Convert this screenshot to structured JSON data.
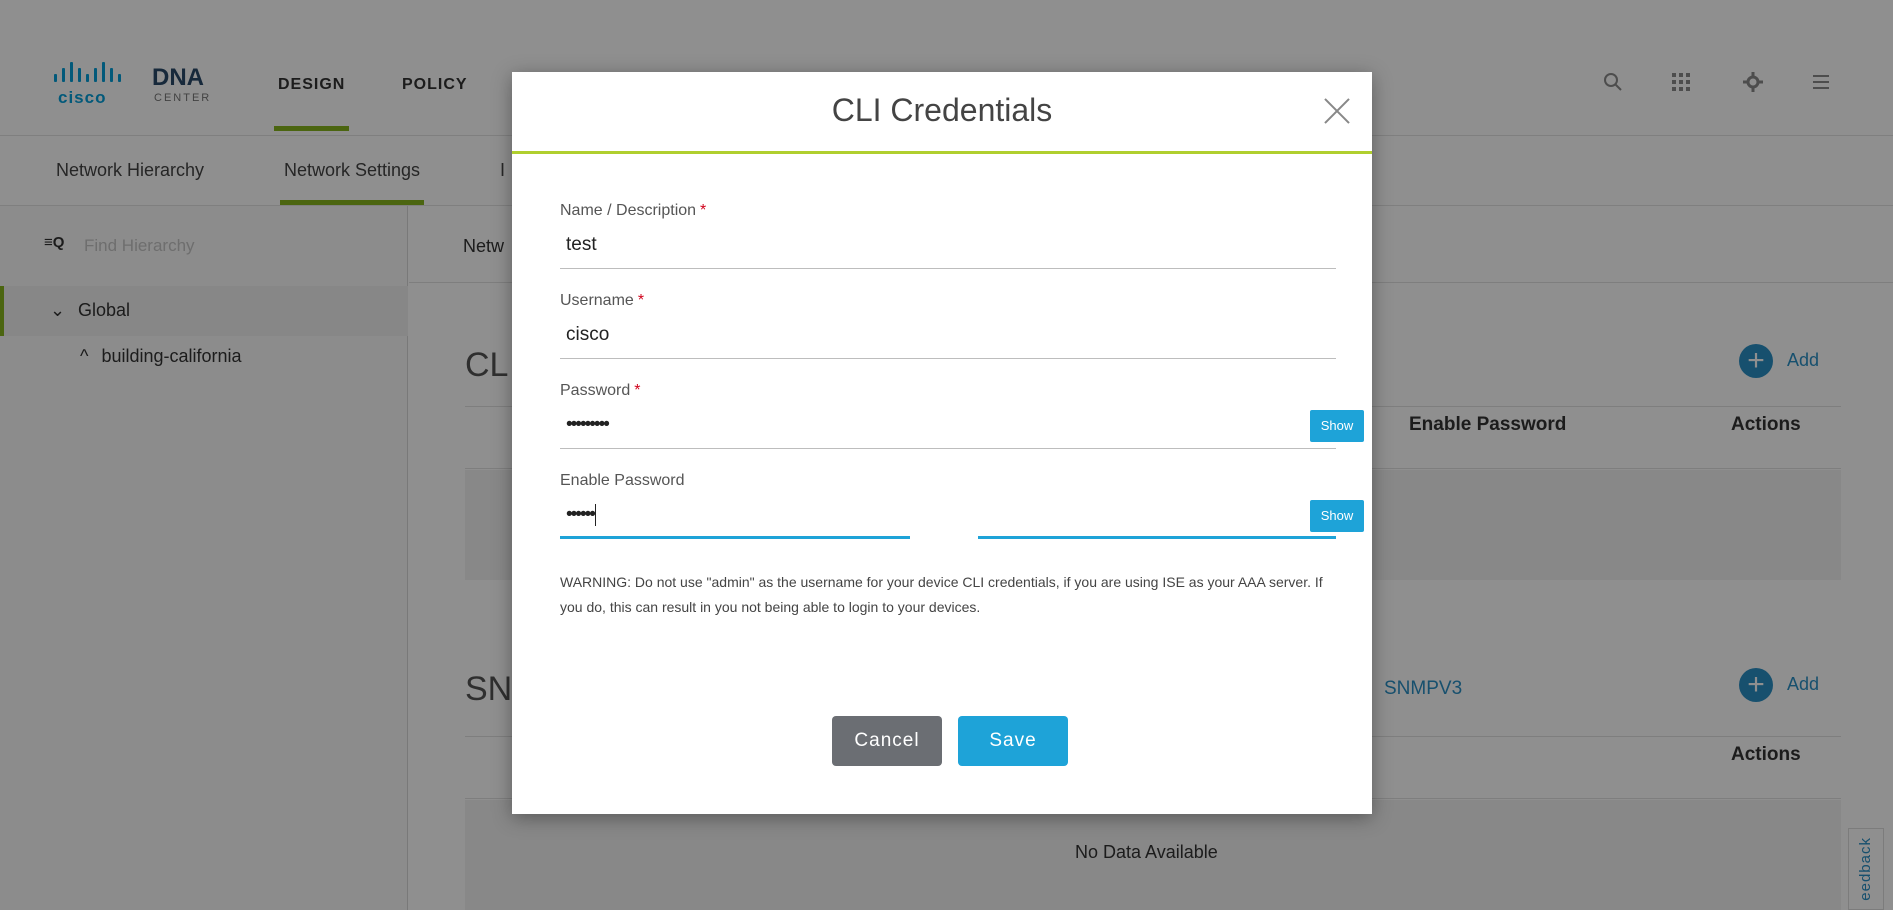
{
  "app": {
    "logo": {
      "cisco": "cisco",
      "dna": "DNA",
      "center": "CENTER"
    },
    "nav": {
      "design": "DESIGN",
      "policy": "POLICY"
    },
    "icons": [
      "search-icon",
      "apps-grid-icon",
      "gear-icon",
      "list-icon"
    ],
    "subnav": {
      "network_hierarchy": "Network Hierarchy",
      "network_settings": "Network Settings",
      "partial_tab": "I"
    },
    "sidebar": {
      "find_placeholder": "Find Hierarchy",
      "global": "Global",
      "child": "building-california"
    },
    "main": {
      "crumb": "Netw",
      "cli_title": "CL",
      "snmp_title": "SN",
      "add_label": "Add",
      "enable_password_col": "Enable Password",
      "actions_col": "Actions",
      "snmpv3_link": "SNMPV3",
      "no_data": "No Data Available"
    },
    "feedback": "eedback",
    "accent_color": "#86b51e",
    "link_color": "#2a8fc4"
  },
  "modal": {
    "title": "CLI Credentials",
    "fields": {
      "name": {
        "label": "Name / Description",
        "required": "*",
        "value": "test"
      },
      "username": {
        "label": "Username",
        "required": "*",
        "value": "cisco"
      },
      "password": {
        "label": "Password",
        "required": "*",
        "value": "•••••••••",
        "show_label": "Show"
      },
      "enable_password": {
        "label": "Enable Password",
        "value": "••••••",
        "show_label": "Show"
      }
    },
    "warning": "WARNING: Do not use \"admin\" as the username for your device CLI credentials, if you are using ISE as your AAA server. If you do, this can result in you not being able to login to your devices.",
    "cancel_label": "Cancel",
    "save_label": "Save",
    "primary_color": "#1ea3d8",
    "header_accent": "#b0cf2e"
  }
}
